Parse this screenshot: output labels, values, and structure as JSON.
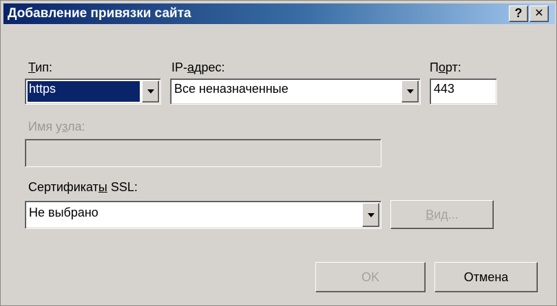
{
  "window": {
    "title": "Добавление привязки сайта",
    "help_label": "?",
    "close_label": "✕"
  },
  "type": {
    "label_pre": "",
    "label_access": "Т",
    "label_post": "ип:",
    "value": "https"
  },
  "ip": {
    "label_pre": "IP-",
    "label_access": "а",
    "label_post": "дрес:",
    "value": "Все неназначенные"
  },
  "port": {
    "label_pre": "П",
    "label_access": "о",
    "label_post": "рт:",
    "value": "443"
  },
  "hostname": {
    "label_pre": "Имя у",
    "label_access": "з",
    "label_post": "ла:",
    "value": ""
  },
  "ssl": {
    "label_pre": "Сертификат",
    "label_access": "ы",
    "label_post": " SSL:",
    "value": "Не выбрано",
    "view_pre": "",
    "view_access": "В",
    "view_post": "ид..."
  },
  "buttons": {
    "ok": "OK",
    "cancel": "Отмена"
  }
}
